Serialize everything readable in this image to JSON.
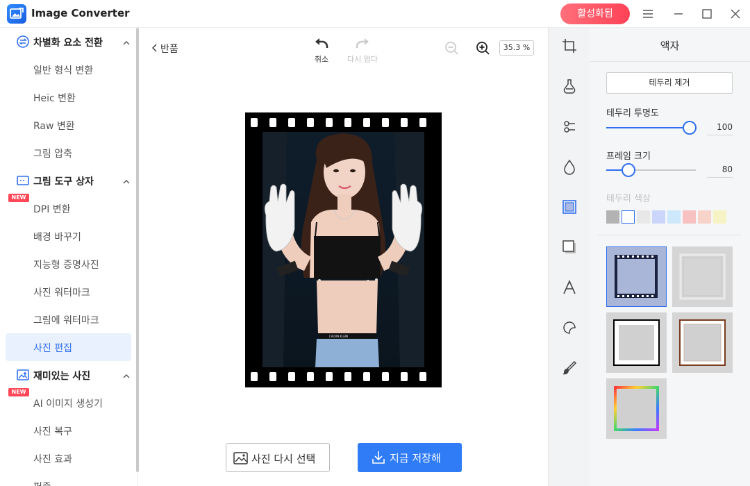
{
  "app": {
    "title": "Image Converter",
    "activate_label": "활성화됨"
  },
  "sidebar": {
    "sections": [
      {
        "label": "차별화 요소 전환",
        "items": [
          "일반 형식 변환",
          "Heic 변환",
          "Raw 변환",
          "그림 압축"
        ]
      },
      {
        "label": "그림 도구 상자",
        "items": [
          "DPI 변환",
          "배경 바꾸기",
          "지능형 증명사진",
          "사진 워터마크",
          "그림에 워터마크",
          "사진 편집"
        ]
      },
      {
        "label": "재미있는 사진",
        "items": [
          "AI 이미지 생성기",
          "사진 복구",
          "사진 효과",
          "퍼즐"
        ]
      }
    ],
    "new_badge": "NEW",
    "active_item": "사진 편집"
  },
  "toolbar": {
    "back_label": "반품",
    "undo_label": "취소",
    "redo_label": "다시 멈다",
    "zoom": "35.3 %"
  },
  "actions": {
    "reselect_label": "사진 다시 선택",
    "save_label": "지금 저장해"
  },
  "panel": {
    "title": "액자",
    "remove_border_label": "테두리 제거",
    "opacity_label": "테두리 투명도",
    "opacity_value": "100",
    "frame_size_label": "프레임 크기",
    "frame_size_value": "80",
    "border_color_label": "테두리 색상",
    "colors": [
      "#b3b3b3",
      "#ffffff",
      "#e8e8e8",
      "#ccd6fb",
      "#cde8fb",
      "#f7c1c1",
      "#f8d3c9",
      "#f6f4c4"
    ],
    "selected_color_index": 1,
    "opacity_level": 1.0,
    "frame_size_level": 0.25
  }
}
